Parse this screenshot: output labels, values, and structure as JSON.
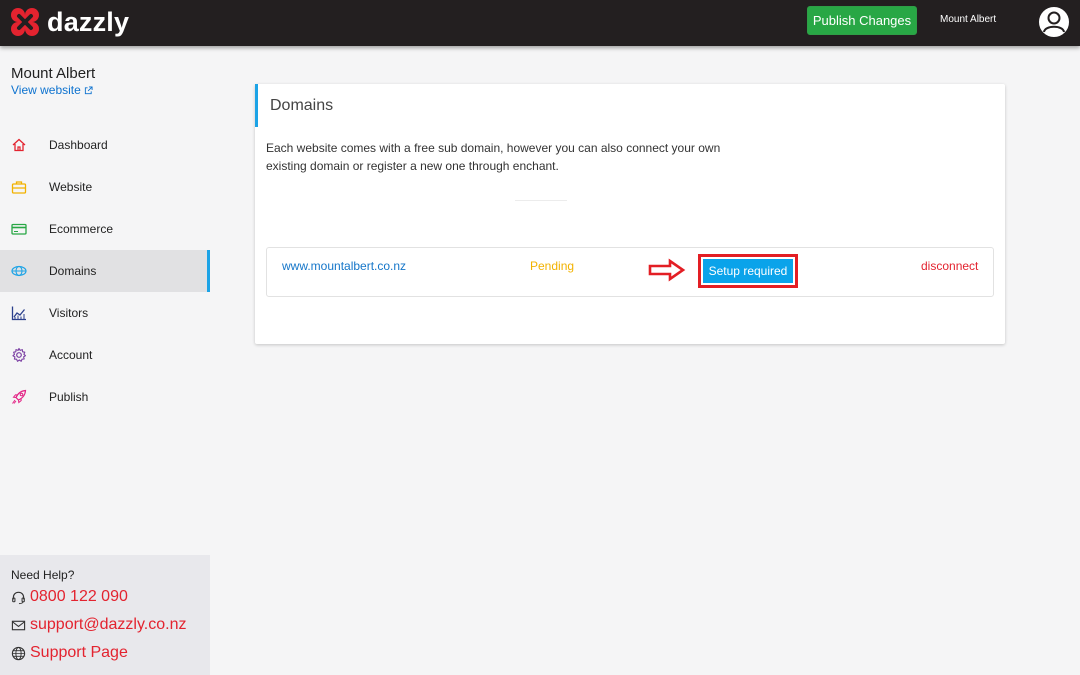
{
  "header": {
    "brand": "dazzly",
    "publish_label": "Publish Changes",
    "user_name": "Mount Albert"
  },
  "sidebar": {
    "site_name": "Mount Albert",
    "view_website": "View website",
    "items": [
      {
        "label": "Dashboard",
        "icon": "home-icon",
        "color": "#e3232f"
      },
      {
        "label": "Website",
        "icon": "briefcase-icon",
        "color": "#f2b200"
      },
      {
        "label": "Ecommerce",
        "icon": "credit-card-icon",
        "color": "#28a745"
      },
      {
        "label": "Domains",
        "icon": "globe-icon",
        "color": "#1ca3e6",
        "active": true
      },
      {
        "label": "Visitors",
        "icon": "chart-icon",
        "color": "#2b3f8c"
      },
      {
        "label": "Account",
        "icon": "gear-icon",
        "color": "#7b3fa3"
      },
      {
        "label": "Publish",
        "icon": "rocket-icon",
        "color": "#e32385"
      }
    ],
    "help": {
      "title": "Need Help?",
      "phone": "0800 122 090",
      "email": "support@dazzly.co.nz",
      "support_page": "Support Page"
    }
  },
  "main": {
    "title": "Domains",
    "description": "Each website comes with a free sub domain, however you can also connect your own existing domain or register a new one through enchant.",
    "domains": [
      {
        "url": "www.mountalbert.co.nz",
        "status": "Pending",
        "action_label": "Setup required",
        "disconnect_label": "disconnect"
      }
    ]
  },
  "colors": {
    "accent": "#1ca3e6",
    "publish": "#28a745",
    "pending": "#f2b200",
    "danger": "#e3232f",
    "topbar": "#231f20"
  }
}
